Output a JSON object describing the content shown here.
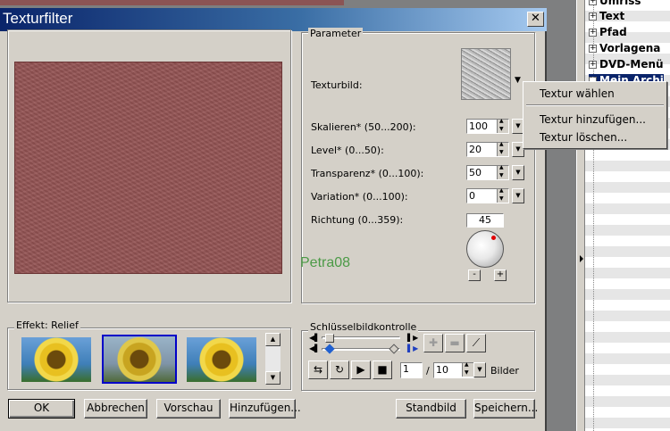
{
  "background_tree": {
    "items": [
      {
        "label": "Umriss",
        "selected": false
      },
      {
        "label": "Text",
        "selected": false
      },
      {
        "label": "Pfad",
        "selected": false
      },
      {
        "label": "Vorlagena",
        "selected": false
      },
      {
        "label": "DVD-Menü",
        "selected": false
      },
      {
        "label": "Mein Archi",
        "selected": true
      }
    ]
  },
  "dialog": {
    "title": "Texturfilter",
    "close_glyph": "✕"
  },
  "parameters": {
    "group_label": "Parameter",
    "texture_label": "Texturbild:",
    "scale": {
      "label": "Skalieren* (50...200):",
      "value": "100"
    },
    "level": {
      "label": "Level* (0...50):",
      "value": "20"
    },
    "transparency": {
      "label": "Transparenz* (0...100):",
      "value": "50"
    },
    "variation": {
      "label": "Variation* (0...100):",
      "value": "0"
    },
    "direction": {
      "label": "Richtung (0...359):",
      "value": "45"
    },
    "minus_label": "-",
    "plus_label": "+"
  },
  "watermark": "Petra08",
  "context_menu": {
    "items": [
      "Textur wählen",
      "Textur hinzufügen...",
      "Textur löschen..."
    ]
  },
  "effect": {
    "group_label": "Effekt: Relief"
  },
  "keyframe": {
    "group_label": "Schlüsselbildkontrolle",
    "frame_current": "1",
    "frame_sep": "/",
    "frame_total": "10",
    "frames_label": "Bilder"
  },
  "buttons": {
    "ok": "OK",
    "cancel": "Abbrechen",
    "preview": "Vorschau",
    "add": "Hinzufügen...",
    "default": "Standbild",
    "save": "Speichern..."
  },
  "colors": {
    "titlebar_start": "#0a246a",
    "titlebar_end": "#a6caf0",
    "preview_texture": "#955454",
    "dialog_face": "#d4d0c8",
    "watermark": "#4c9a47"
  }
}
